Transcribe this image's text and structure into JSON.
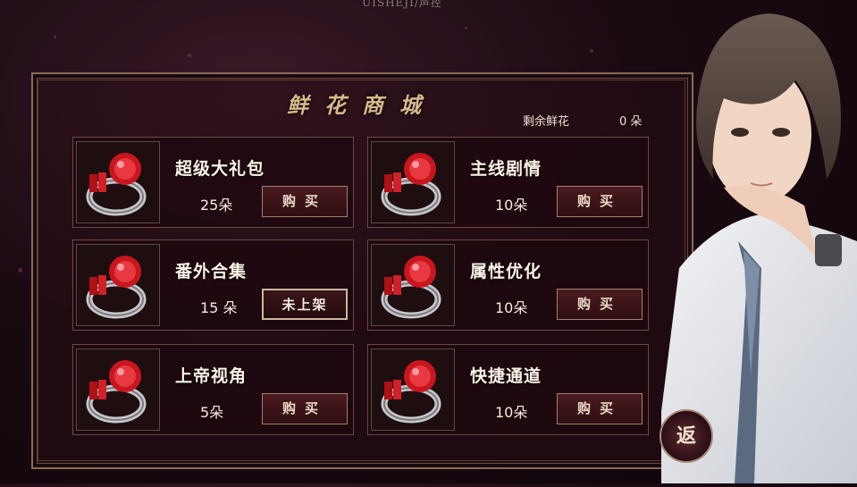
{
  "top_caption": "UISHEJI/声控",
  "shop": {
    "title": "鲜花商城",
    "remaining_label": "剩余鲜花",
    "remaining_value": "0 朵"
  },
  "items": [
    {
      "name": "超级大礼包",
      "price": "25朵",
      "button": "购买",
      "icon": "ruby-ring-icon"
    },
    {
      "name": "主线剧情",
      "price": "10朵",
      "button": "购买",
      "icon": "ruby-ring-icon"
    },
    {
      "name": "番外合集",
      "price": "15 朵",
      "button": "未上架",
      "icon": "ruby-ring-icon"
    },
    {
      "name": "属性优化",
      "price": "10朵",
      "button": "购买",
      "icon": "ruby-ring-icon"
    },
    {
      "name": "上帝视角",
      "price": "5朵",
      "button": "购买",
      "icon": "ruby-ring-icon"
    },
    {
      "name": "快捷通道",
      "price": "10朵",
      "button": "购买",
      "icon": "ruby-ring-icon"
    }
  ],
  "back_button": "返",
  "colors": {
    "frame": "#8a6a5a",
    "title": "#d6b98a",
    "ruby": "#c8161e",
    "background": "#1a0a12"
  }
}
